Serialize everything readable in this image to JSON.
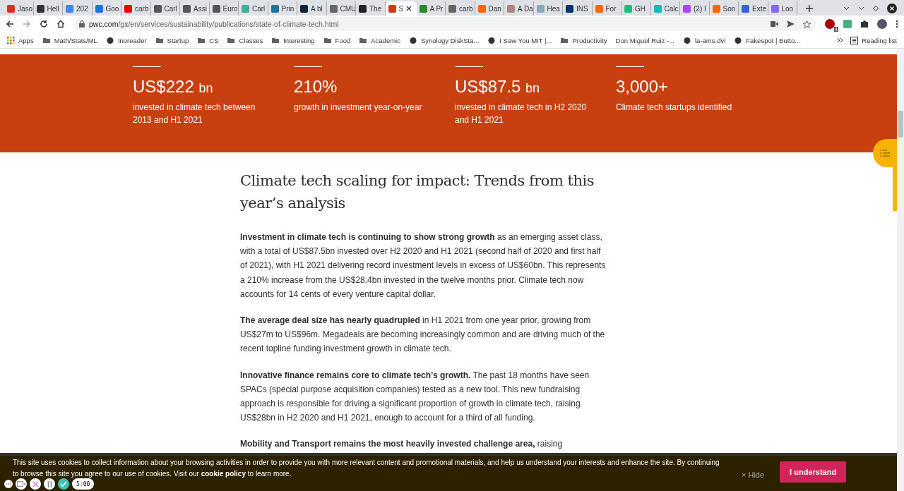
{
  "tabs": [
    {
      "label": "Jaso",
      "selected": false
    },
    {
      "label": "Hell",
      "selected": false
    },
    {
      "label": "202",
      "selected": false
    },
    {
      "label": "Goo",
      "selected": false
    },
    {
      "label": "carb",
      "selected": false
    },
    {
      "label": "Carl",
      "selected": false
    },
    {
      "label": "Assi",
      "selected": false
    },
    {
      "label": "Euro",
      "selected": false
    },
    {
      "label": "Carl",
      "selected": false
    },
    {
      "label": "Prin",
      "selected": false
    },
    {
      "label": "A bl",
      "selected": false
    },
    {
      "label": "CMU",
      "selected": false
    },
    {
      "label": "The",
      "selected": false
    },
    {
      "label": "S",
      "selected": true
    },
    {
      "label": "A Pr",
      "selected": false
    },
    {
      "label": "carb",
      "selected": false
    },
    {
      "label": "Dan",
      "selected": false
    },
    {
      "label": "A Da",
      "selected": false
    },
    {
      "label": "Hea",
      "selected": false
    },
    {
      "label": "INS",
      "selected": false
    },
    {
      "label": "For",
      "selected": false
    },
    {
      "label": "GH",
      "selected": false
    },
    {
      "label": "Calc",
      "selected": false
    },
    {
      "label": "(2) I",
      "selected": false
    },
    {
      "label": "Son",
      "selected": false
    },
    {
      "label": "Exte",
      "selected": false
    },
    {
      "label": "Loo",
      "selected": false
    }
  ],
  "address": {
    "domain": "pwc.com",
    "path": "/gx/en/services/sustainability/publications/state-of-climate-tech.html"
  },
  "extension_badge": "4",
  "bookmarks": [
    {
      "label": "Apps",
      "kind": "apps"
    },
    {
      "label": "Math/Stats/ML",
      "kind": "folder"
    },
    {
      "label": "Inoreader",
      "kind": "site"
    },
    {
      "label": "Startup",
      "kind": "folder"
    },
    {
      "label": "CS",
      "kind": "folder"
    },
    {
      "label": "Classes",
      "kind": "folder"
    },
    {
      "label": "Interesting",
      "kind": "folder"
    },
    {
      "label": "Food",
      "kind": "folder"
    },
    {
      "label": "Academic",
      "kind": "folder"
    },
    {
      "label": "Synology DiskSta...",
      "kind": "site"
    },
    {
      "label": "I Saw You MIT |...",
      "kind": "site"
    },
    {
      "label": "Productivity",
      "kind": "folder"
    },
    {
      "label": "Don Miguel Ruiz -...",
      "kind": "plain"
    },
    {
      "label": "la-ams.dvi",
      "kind": "site"
    },
    {
      "label": "Fakespot | Butto...",
      "kind": "site"
    }
  ],
  "reading_list": "Reading list",
  "stats": [
    {
      "value": "US$222",
      "unit": "bn",
      "caption": "invested in climate tech between 2013 and H1 2021"
    },
    {
      "value": "210%",
      "caption": "growth in investment year-on-year"
    },
    {
      "value": "US$87.5",
      "unit": "bn",
      "caption": "invested in climate tech in H2 2020 and H1 2021"
    },
    {
      "value": "3,000+",
      "caption": "Climate tech startups identified"
    }
  ],
  "article": {
    "heading": "Climate tech scaling for impact: Trends from this year’s analysis",
    "paragraphs": [
      "**Investment in climate tech is continuing to show strong growth** as an emerging asset class, with a total of US$87.5bn invested over H2 2020 and H1 2021 (second half of 2020 and first half of 2021), with H1 2021 delivering record investment levels in excess of US$60bn. This represents a 210% increase from the US$28.4bn invested in the twelve months prior. Climate tech now accounts for 14 cents of every venture capital dollar.",
      "**The average deal size has nearly quadrupled** in H1 2021 from one year prior, growing from US$27m to US$96m. Megadeals are becoming increasingly common and are driving much of the recent topline funding investment growth in climate tech.",
      "**Innovative finance remains core to climate tech’s growth.** The past 18 months have seen SPACs (special purpose acquisition companies) tested as a new tool. This new fundraising approach is responsible for driving a significant proportion of growth in climate tech, raising US$28bn in H2 2020 and H1 2021, enough to account for a third of all funding.",
      "**Mobility and Transport remains the most heavily invested challenge area,** raising"
    ]
  },
  "cookie": {
    "text_before": "This site uses cookies to collect information about your browsing activities in order to provide you with more relevant content and promotional materials, and help us understand your interests and enhance the site. By continuing to browse this site you agree to our use of cookies. Visit our",
    "link": "cookie policy",
    "text_after": "to learn more.",
    "hide": "× Hide",
    "accept": "I understand"
  },
  "recorder": {
    "timer": "5:00"
  }
}
